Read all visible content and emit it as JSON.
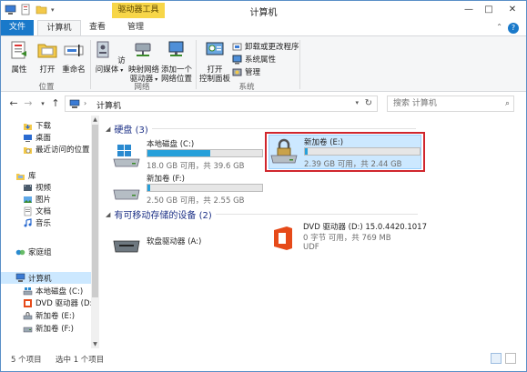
{
  "window": {
    "title": "计算机",
    "context_tab": "驱动器工具"
  },
  "tabs": {
    "file": "文件",
    "computer": "计算机",
    "view": "查看",
    "manage": "管理"
  },
  "ribbon": {
    "properties": "属性",
    "open": "打开",
    "rename": "重命名",
    "access_media": "访问媒体",
    "map_drive_1": "映射网络",
    "map_drive_2": "驱动器",
    "add_location_1": "添加一个",
    "add_location_2": "网络位置",
    "open_cp_1": "打开",
    "open_cp_2": "控制面板",
    "uninstall": "卸载或更改程序",
    "sysprops": "系统属性",
    "manage": "管理",
    "group_location": "位置",
    "group_network": "网络",
    "group_system": "系统"
  },
  "address": {
    "path": "计算机",
    "search_placeholder": "搜索 计算机"
  },
  "nav": {
    "downloads": "下载",
    "desktop": "桌面",
    "recent": "最近访问的位置",
    "libraries": "库",
    "videos": "视频",
    "pictures": "图片",
    "documents": "文档",
    "music": "音乐",
    "homegroup": "家庭组",
    "computer": "计算机",
    "local_c": "本地磁盘 (C:)",
    "dvd_d": "DVD 驱动器 (D:)",
    "vol_e": "新加卷 (E:)",
    "vol_f": "新加卷 (F:)"
  },
  "sections": {
    "hard_disks": "硬盘 (3)",
    "removable": "有可移动存储的设备 (2)"
  },
  "drives": {
    "c": {
      "name": "本地磁盘 (C:)",
      "free": "18.0 GB 可用，共 39.6 GB",
      "used_fraction": 0.545
    },
    "e": {
      "name": "新加卷 (E:)",
      "free": "2.39 GB 可用，共 2.44 GB",
      "used_fraction": 0.02
    },
    "f": {
      "name": "新加卷 (F:)",
      "free": "2.50 GB 可用，共 2.55 GB",
      "used_fraction": 0.02
    },
    "a": {
      "name": "软盘驱动器 (A:)"
    },
    "d": {
      "name": "DVD 驱动器 (D:) 15.0.4420.1017",
      "free": "0 字节 可用，共 769 MB",
      "fs": "UDF"
    }
  },
  "status": {
    "count": "5 个项目",
    "selected": "选中 1 个项目"
  },
  "colors": {
    "accent": "#1979ca",
    "bar_fill": "#26a0da",
    "selection": "#cce8ff",
    "highlight_border": "#d0262d",
    "office_orange": "#e64a19"
  }
}
